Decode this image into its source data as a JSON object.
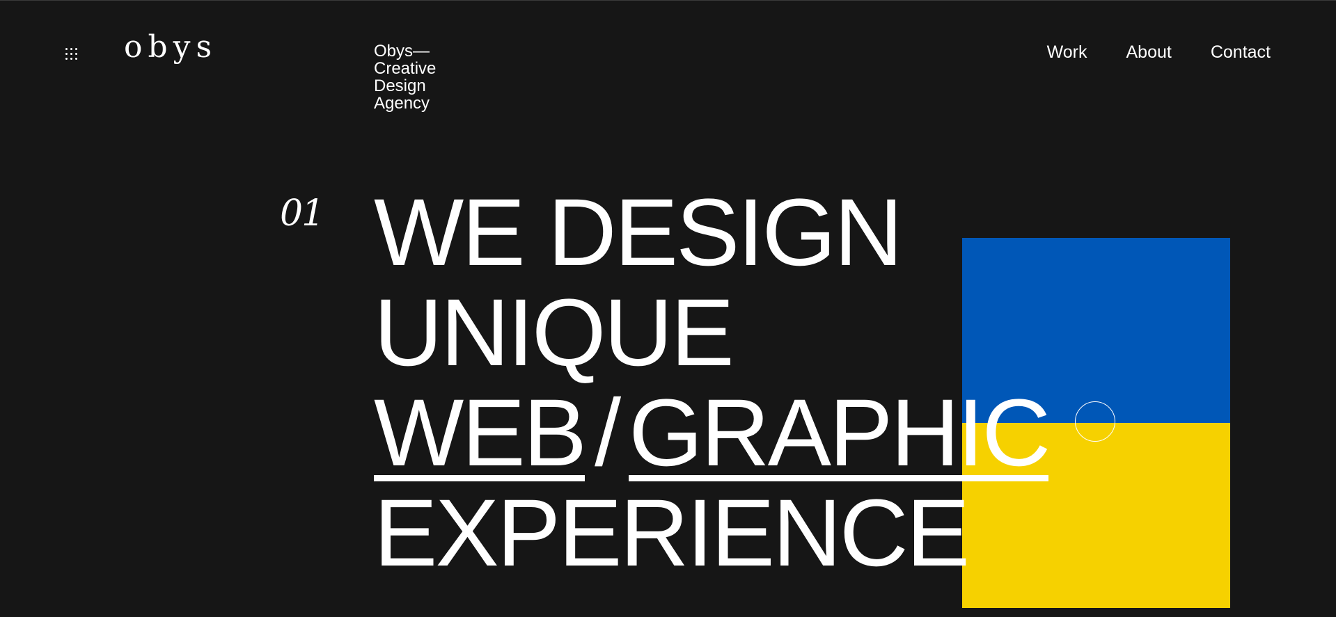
{
  "header": {
    "logo": "obys",
    "tagline": [
      "Obys—",
      "Creative",
      "Design",
      "Agency"
    ],
    "nav": [
      {
        "label": "Work"
      },
      {
        "label": "About"
      },
      {
        "label": "Contact"
      }
    ]
  },
  "hero": {
    "number": "01",
    "lines": [
      "WE DESIGN",
      "UNIQUE"
    ],
    "link_web": "WEB",
    "separator": "/",
    "link_graphic": "GRAPHIC",
    "last_line": "EXPERIENCE"
  },
  "colors": {
    "background": "#161616",
    "text": "#ffffff",
    "flag_blue": "#0057b7",
    "flag_yellow": "#f6d100"
  },
  "icons": {
    "menu": "grid-dots-icon",
    "cursor": "cursor-circle-icon"
  }
}
